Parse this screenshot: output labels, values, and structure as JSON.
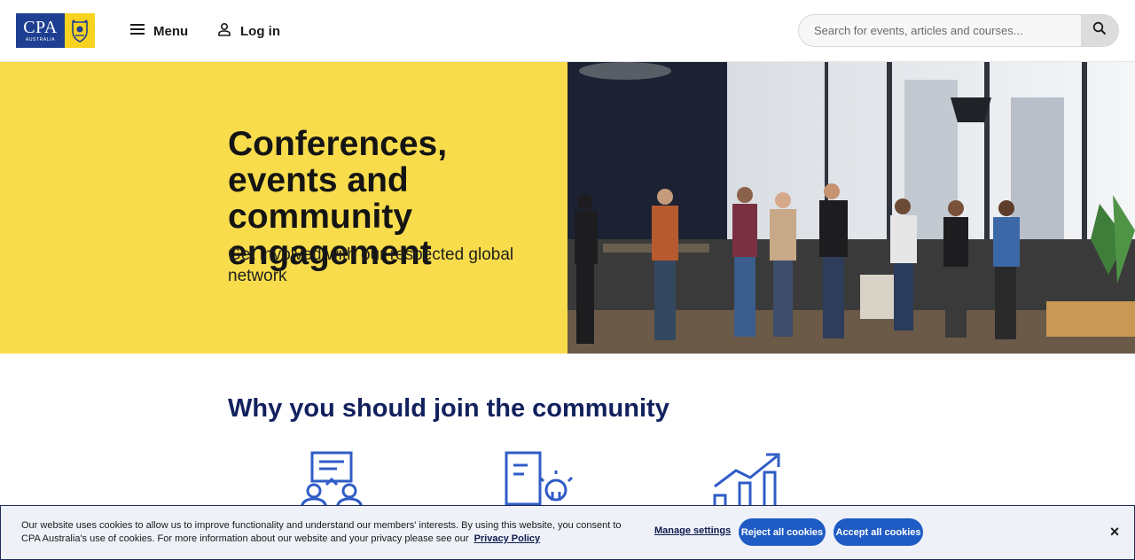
{
  "brand": {
    "logo_text": "CPA",
    "logo_subtext": "AUSTRALIA"
  },
  "header": {
    "menu_label": "Menu",
    "login_label": "Log in",
    "search_placeholder": "Search for events, articles and courses..."
  },
  "hero": {
    "title": "Conferences, events and community engagement",
    "subtitle": "Get involved with our respected global network"
  },
  "section": {
    "title": "Why you should join the community"
  },
  "cookie_banner": {
    "text": "Our website uses cookies to allow us to improve functionality and understand our members' interests. By using this website, you consent to CPA Australia's use of cookies. For more information about our website and your privacy please see our",
    "privacy_link": "Privacy Policy",
    "manage_label": "Manage settings",
    "reject_label": "Reject all cookies",
    "accept_label": "Accept all cookies",
    "close_symbol": "×"
  },
  "colors": {
    "brand_blue": "#1e3f91",
    "brand_yellow": "#f7d21e",
    "hero_yellow": "#f8dc4c",
    "heading_navy": "#12215e",
    "button_blue": "#1f5bc4",
    "icon_blue": "#2f5cc7"
  },
  "icons": [
    "hamburger-icon",
    "user-icon",
    "search-icon",
    "audience-icon",
    "book-lightbulb-icon",
    "growth-chart-icon",
    "close-icon"
  ]
}
